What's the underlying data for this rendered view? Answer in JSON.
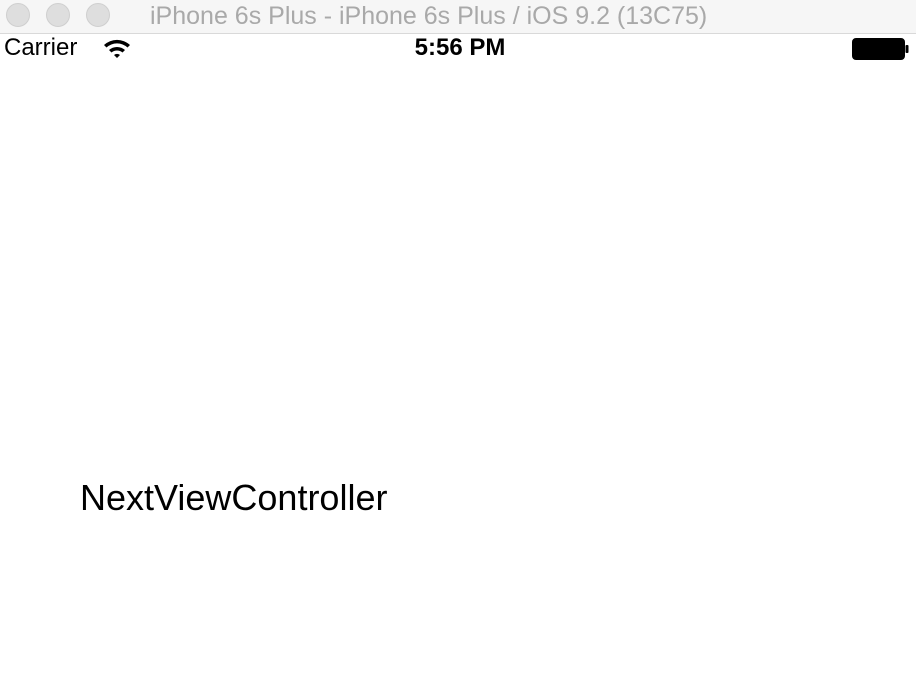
{
  "window": {
    "title": "iPhone 6s Plus - iPhone 6s Plus / iOS 9.2 (13C75)",
    "controls": [
      "close",
      "minimize",
      "zoom"
    ]
  },
  "status_bar": {
    "carrier": "Carrier",
    "signal_icon": "wifi-icon",
    "time": "5:56 PM",
    "battery_icon": "battery-icon",
    "battery_level": 1.0
  },
  "content": {
    "label": "NextViewController"
  }
}
